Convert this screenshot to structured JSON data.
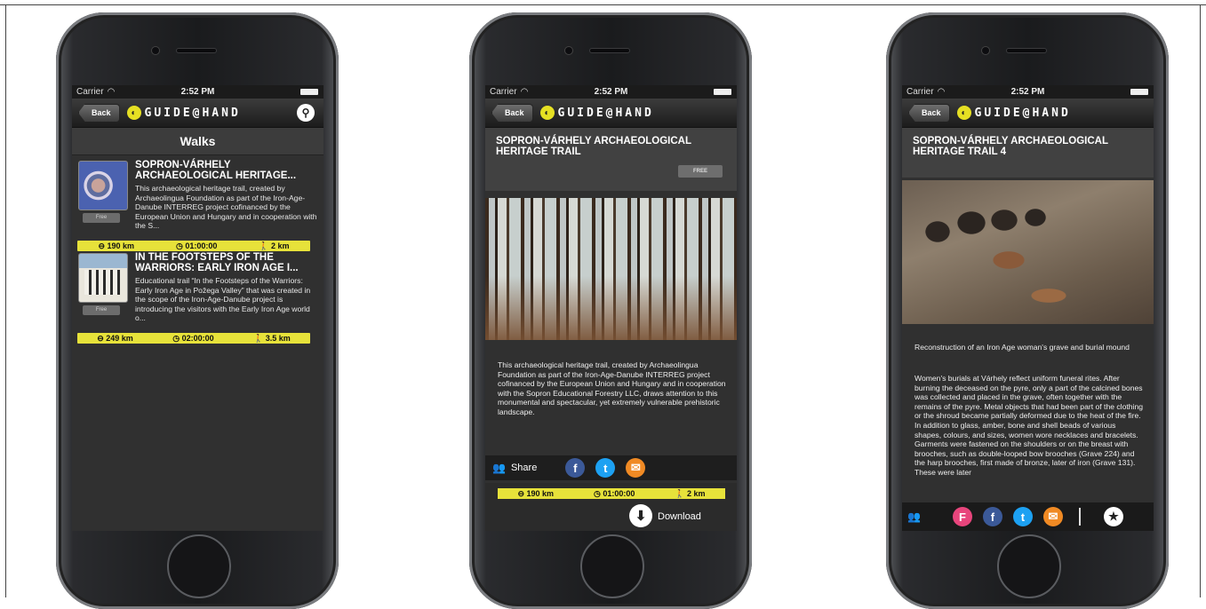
{
  "status": {
    "carrier": "Carrier",
    "time": "2:52 PM"
  },
  "nav": {
    "back_label": "Back",
    "logo_text": "GUIDE@HAND"
  },
  "screen1": {
    "title": "Walks",
    "walks": [
      {
        "title": "SOPRON-VÁRHELY ARCHAEOLOGICAL HERITAGE...",
        "description": "This archaeological heritage trail, created by Archaeolingua Foundation as part of the Iron-Age-Danube INTERREG project cofinanced by the European Union and Hungary and in cooperation with the S...",
        "badge": "Free",
        "distance": "190 km",
        "duration": "01:00:00",
        "length": "2 km"
      },
      {
        "title": "IN THE FOOTSTEPS OF THE WARRIORS: EARLY IRON AGE I...",
        "description": "Educational trail “In the Footsteps of the Warriors: Early Iron Age in Požega Valley” that was created in the scope of the Iron-Age-Danube project is introducing the visitors with the Early Iron Age world o...",
        "badge": "Free",
        "distance": "249 km",
        "duration": "02:00:00",
        "length": "3.5 km"
      }
    ]
  },
  "screen2": {
    "title": "SOPRON-VÁRHELY ARCHAEOLOGICAL HERITAGE TRAIL",
    "badge": "Free",
    "description": "This archaeological heritage trail, created by Archaeolingua Foundation as part of the Iron-Age-Danube INTERREG project cofinanced by the European Union and Hungary and in cooperation with the Sopron Educational Forestry LLC, draws attention to this monumental and spectacular, yet extremely vulnerable prehistoric landscape.",
    "share_label": "Share",
    "distance": "190 km",
    "duration": "01:00:00",
    "length": "2 km",
    "download_label": "Download"
  },
  "screen3": {
    "title": "SOPRON-VÁRHELY ARCHAEOLOGICAL HERITAGE TRAIL 4",
    "caption": "Reconstruction of an Iron Age woman's grave and burial mound",
    "body": "Women's burials at Várhely reflect uniform funeral rites. After burning the deceased on the pyre, only a part of the calcined bones was collected and placed in the grave, often together with the remains of the pyre. Metal objects that had been part of the clothing or the shroud became partially deformed due to the heat of the fire. In addition to glass, amber, bone and shell beads of various shapes, colours, and sizes, women wore necklaces and bracelets. Garments were fastened on the shoulders or on the breast with brooches, such as double-looped bow brooches (Grave 224) and the harp brooches, first made of bronze, later of iron (Grave 131). These were later"
  },
  "colors": {
    "accent": "#e7e23a",
    "facebook": "#3b5998",
    "twitter": "#1da1f2",
    "mail": "#f08a24",
    "foursquare": "#e8457c"
  }
}
